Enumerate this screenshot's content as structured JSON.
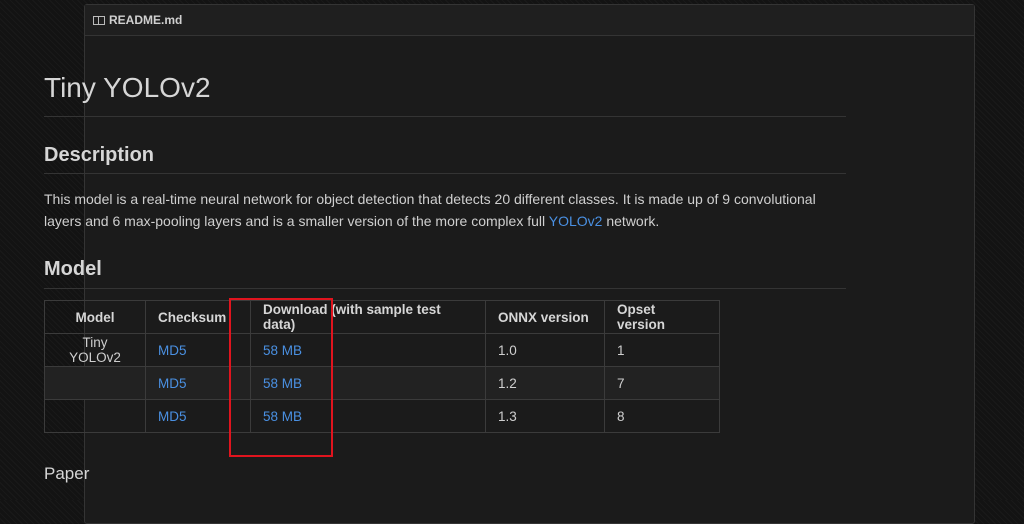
{
  "header": {
    "filename": "README.md",
    "icon": "book-icon"
  },
  "title": "Tiny YOLOv2",
  "description": {
    "heading": "Description",
    "text_before_link": "This model is a real-time neural network for object detection that detects 20 different classes. It is made up of 9 convolutional layers and 6 max-pooling layers and is a smaller version of the more complex full ",
    "link": "YOLOv2",
    "text_after_link": " network."
  },
  "model_section": {
    "heading": "Model",
    "columns": [
      "Model",
      "Checksum",
      "Download (with sample test data)",
      "ONNX version",
      "Opset version"
    ],
    "rows": [
      {
        "model": "Tiny YOLOv2",
        "checksum": "MD5",
        "download": "58 MB",
        "onnx": "1.0",
        "opset": "1"
      },
      {
        "model": "",
        "checksum": "MD5",
        "download": "58 MB",
        "onnx": "1.2",
        "opset": "7"
      },
      {
        "model": "",
        "checksum": "MD5",
        "download": "58 MB",
        "onnx": "1.3",
        "opset": "8"
      }
    ]
  },
  "paper": {
    "heading": "Paper"
  },
  "colors": {
    "link": "#4a90e2",
    "highlight": "#e0141e",
    "background": "#1b1b1b"
  }
}
